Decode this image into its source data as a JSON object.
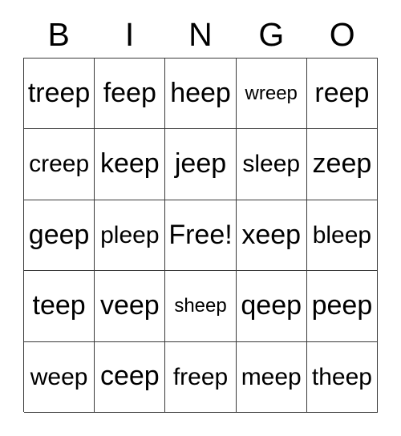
{
  "card": {
    "title": "BINGO",
    "headers": [
      {
        "letter": "B"
      },
      {
        "letter": "I"
      },
      {
        "letter": "N"
      },
      {
        "letter": "G"
      },
      {
        "letter": "O"
      }
    ],
    "free_space_label": "Free!",
    "free_space_position": {
      "row": 2,
      "col": 2
    },
    "border_color": "#3a3a3a",
    "text_color": "#000000",
    "background_color": "#ffffff",
    "rows": [
      [
        {
          "text": "treep",
          "size": "sz-lg"
        },
        {
          "text": "feep",
          "size": "sz-lg"
        },
        {
          "text": "heep",
          "size": "sz-lg"
        },
        {
          "text": "wreep",
          "size": "sz-sm"
        },
        {
          "text": "reep",
          "size": "sz-lg"
        }
      ],
      [
        {
          "text": "creep",
          "size": "sz-md"
        },
        {
          "text": "keep",
          "size": "sz-lg"
        },
        {
          "text": "jeep",
          "size": "sz-lg"
        },
        {
          "text": "sleep",
          "size": "sz-md"
        },
        {
          "text": "zeep",
          "size": "sz-lg"
        }
      ],
      [
        {
          "text": "geep",
          "size": "sz-lg"
        },
        {
          "text": "pleep",
          "size": "sz-md"
        },
        {
          "text": "Free!",
          "size": "sz-lg"
        },
        {
          "text": "xeep",
          "size": "sz-lg"
        },
        {
          "text": "bleep",
          "size": "sz-md"
        }
      ],
      [
        {
          "text": "teep",
          "size": "sz-lg"
        },
        {
          "text": "veep",
          "size": "sz-lg"
        },
        {
          "text": "sheep",
          "size": "sz-sm"
        },
        {
          "text": "qeep",
          "size": "sz-lg"
        },
        {
          "text": "peep",
          "size": "sz-lg"
        }
      ],
      [
        {
          "text": "weep",
          "size": "sz-md"
        },
        {
          "text": "ceep",
          "size": "sz-lg"
        },
        {
          "text": "freep",
          "size": "sz-md"
        },
        {
          "text": "meep",
          "size": "sz-md"
        },
        {
          "text": "theep",
          "size": "sz-md"
        }
      ]
    ]
  }
}
